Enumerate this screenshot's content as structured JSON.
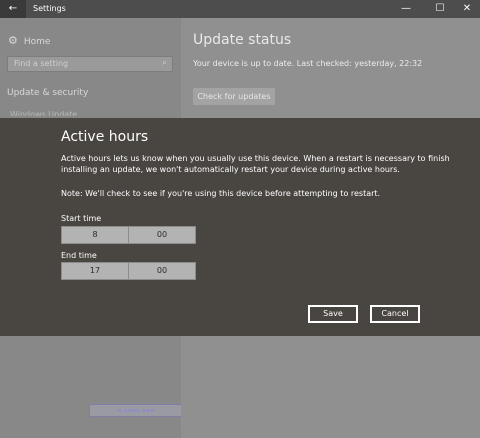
{
  "window": {
    "title": "Settings",
    "back_glyph": "←",
    "minimize_glyph": "—",
    "maximize_glyph": "☐",
    "close_glyph": "✕"
  },
  "sidebar": {
    "home_label": "Home",
    "search_placeholder": "Find a setting",
    "section_label": "Update & security",
    "partial_item": "Windows Update"
  },
  "main": {
    "title": "Update status",
    "status_text": "Your device is up to date. Last checked: yesterday, 22:32",
    "check_button": "Check for updates"
  },
  "dialog": {
    "title": "Active hours",
    "description": "Active hours lets us know when you usually use this device. When a restart is necessary to finish installing an update, we won't automatically restart your device during active hours.",
    "note": "Note: We'll check to see if you're using this device before attempting to restart.",
    "start_label": "Start time",
    "start_hour": "8",
    "start_minute": "00",
    "end_label": "End time",
    "end_hour": "17",
    "end_minute": "00",
    "save_label": "Save",
    "cancel_label": "Cancel"
  },
  "colors": {
    "dialog_bg": "#494541",
    "overlay": "#888888"
  }
}
